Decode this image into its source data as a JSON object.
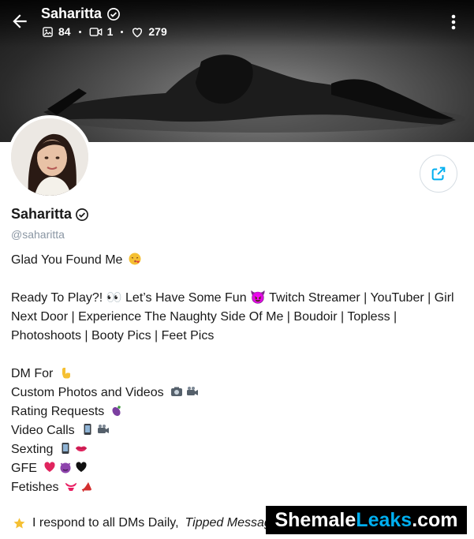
{
  "header": {
    "title": "Saharitta",
    "stats": {
      "photos": "84",
      "videos": "1",
      "likes": "279"
    },
    "icons": {
      "back": "arrow-left-icon",
      "more": "kebab-menu-icon",
      "photos": "image-icon",
      "videos": "video-camera-icon",
      "likes": "heart-icon",
      "verified": "verified-badge-icon"
    }
  },
  "profile": {
    "name": "Saharitta",
    "handle": "@saharitta",
    "share_icon": "share-icon"
  },
  "bio": {
    "greeting": "Glad You Found Me",
    "intro_line1": "Ready To Play?! 👀 Let’s Have Some Fun 😈 Twitch Streamer | YouTuber | Girl",
    "intro_line2": "Next Door | Experience The Naughty Side Of Me | Boudoir | Topless |",
    "intro_line3": "Photoshoots | Booty Pics | Feet Pics",
    "dm_title": "DM For",
    "offers": [
      {
        "label": "Custom Photos and Videos"
      },
      {
        "label": "Rating Requests"
      },
      {
        "label": "Video Calls"
      },
      {
        "label": "Sexting"
      },
      {
        "label": "GFE"
      },
      {
        "label": "Fetishes"
      }
    ],
    "note_prefix": "I respond to all DMs Daily,",
    "note_italic": "Tipped Message"
  },
  "watermark": {
    "prefix": "Shemale",
    "accent": "Leaks",
    "suffix": ".com"
  },
  "colors": {
    "accent": "#00aff0",
    "muted": "#8a96a3",
    "text": "#1a1a1a"
  }
}
